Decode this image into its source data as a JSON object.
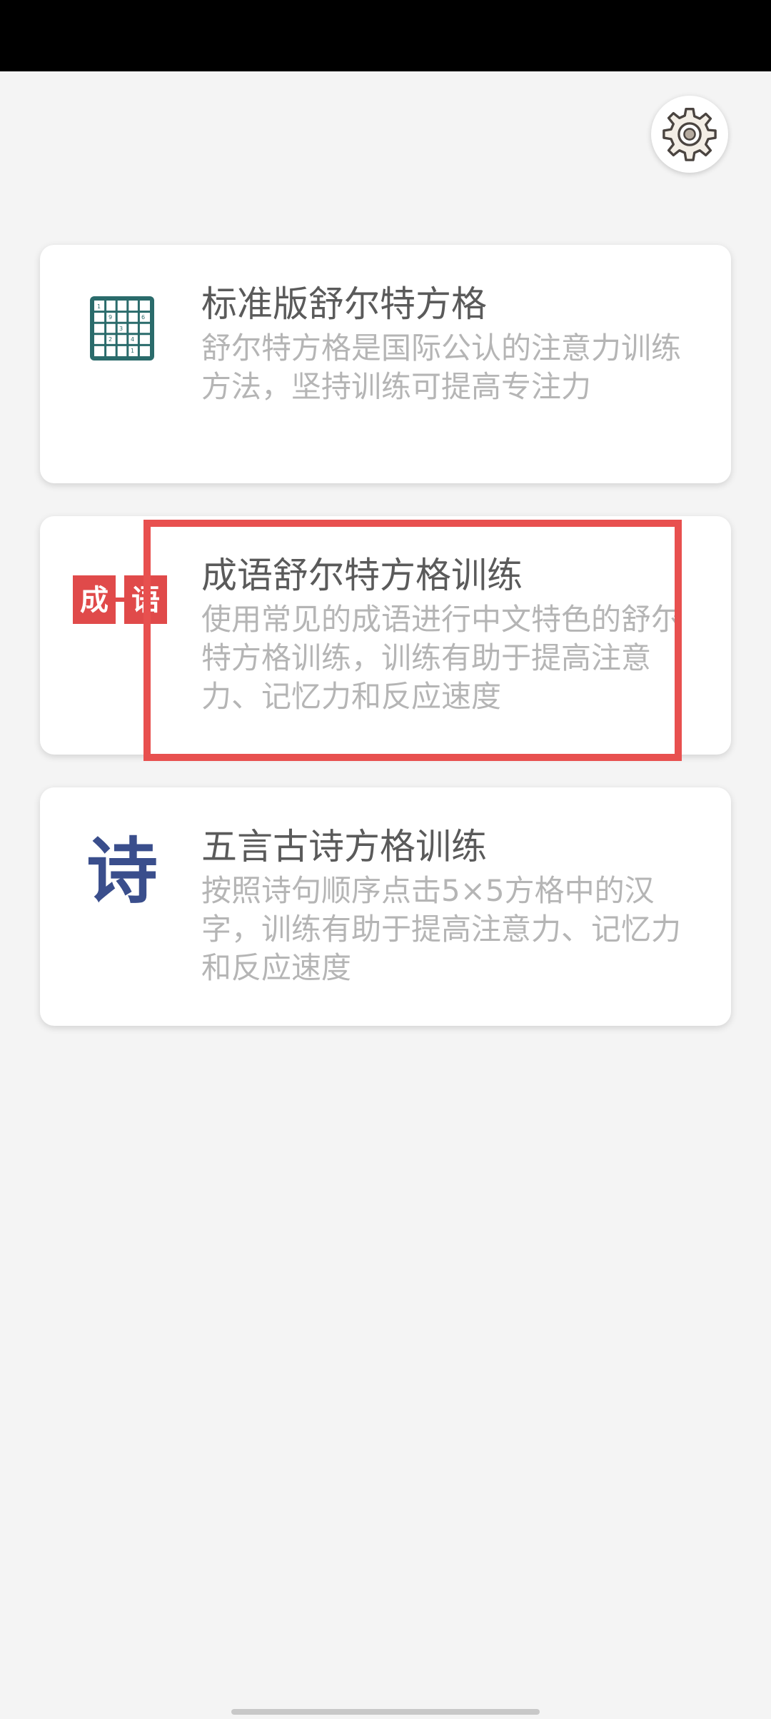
{
  "cards": [
    {
      "icon": "schulte-grid-icon",
      "title": "标准版舒尔特方格",
      "description": "舒尔特方格是国际公认的注意力训练方法，坚持训练可提高专注力"
    },
    {
      "icon": "idiom-icon",
      "icon_text": "成语",
      "title": "成语舒尔特方格训练",
      "description": "使用常见的成语进行中文特色的舒尔特方格训练，训练有助于提高注意力、记忆力和反应速度"
    },
    {
      "icon": "poem-icon",
      "icon_text": "诗",
      "title": "五言古诗方格训练",
      "description": "按照诗句顺序点击5×5方格中的汉字，训练有助于提高注意力、记忆力和反应速度"
    }
  ],
  "settings": {
    "icon": "gear-icon"
  },
  "colors": {
    "grid_icon": "#2a6b6b",
    "idiom_icon": "#e04a4a",
    "poem_icon": "#3a4e8c",
    "highlight": "#e8504f"
  }
}
